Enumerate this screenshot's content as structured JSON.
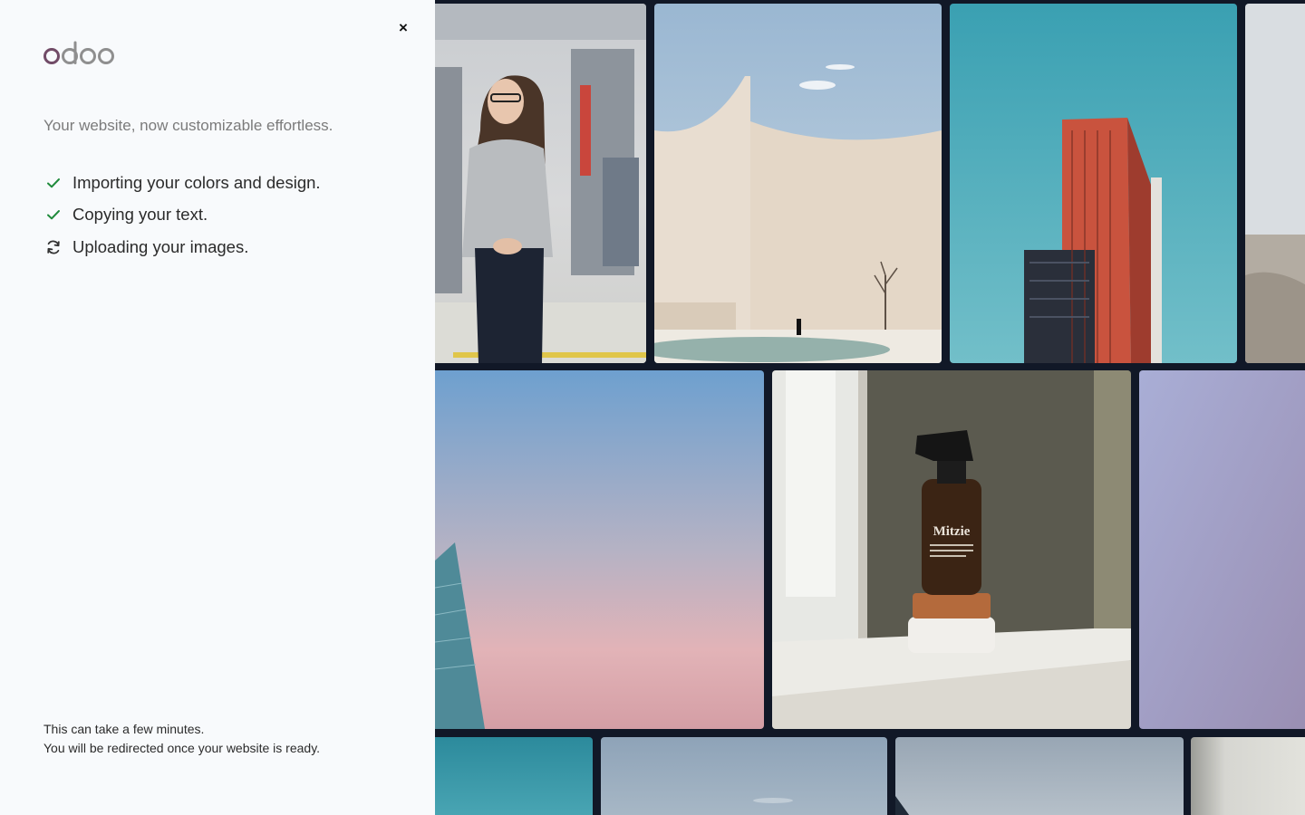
{
  "dialog": {
    "close_label": "×",
    "tagline": "Your website, now customizable effortless.",
    "steps": [
      {
        "label": "Importing your colors and design.",
        "status": "done",
        "icon": "check-icon"
      },
      {
        "label": "Copying your text.",
        "status": "done",
        "icon": "check-icon"
      },
      {
        "label": "Uploading your images.",
        "status": "in-progress",
        "icon": "refresh-icon"
      }
    ],
    "footer": {
      "line1": "This can take a few minutes.",
      "line2": "You will be redirected once your website is ready."
    }
  },
  "brand": {
    "logo_text": "odoo",
    "colors": {
      "odoo_purple": "#714B67",
      "odoo_gray": "#8F8F8F",
      "success_green": "#1f8a3b"
    }
  },
  "gallery": {
    "images": [
      {
        "name": "woman-in-factory-image"
      },
      {
        "name": "curved-wall-architecture-image"
      },
      {
        "name": "red-tower-building-image"
      },
      {
        "name": "desert-landscape-image"
      },
      {
        "name": "pastel-sky-skyscraper-image"
      },
      {
        "name": "spray-bottle-product-image",
        "label": "Mitzie"
      },
      {
        "name": "lavender-gradient-image"
      },
      {
        "name": "teal-sky-image"
      },
      {
        "name": "gray-sky-image"
      },
      {
        "name": "overcast-sky-image"
      },
      {
        "name": "pale-gray-image"
      }
    ]
  }
}
